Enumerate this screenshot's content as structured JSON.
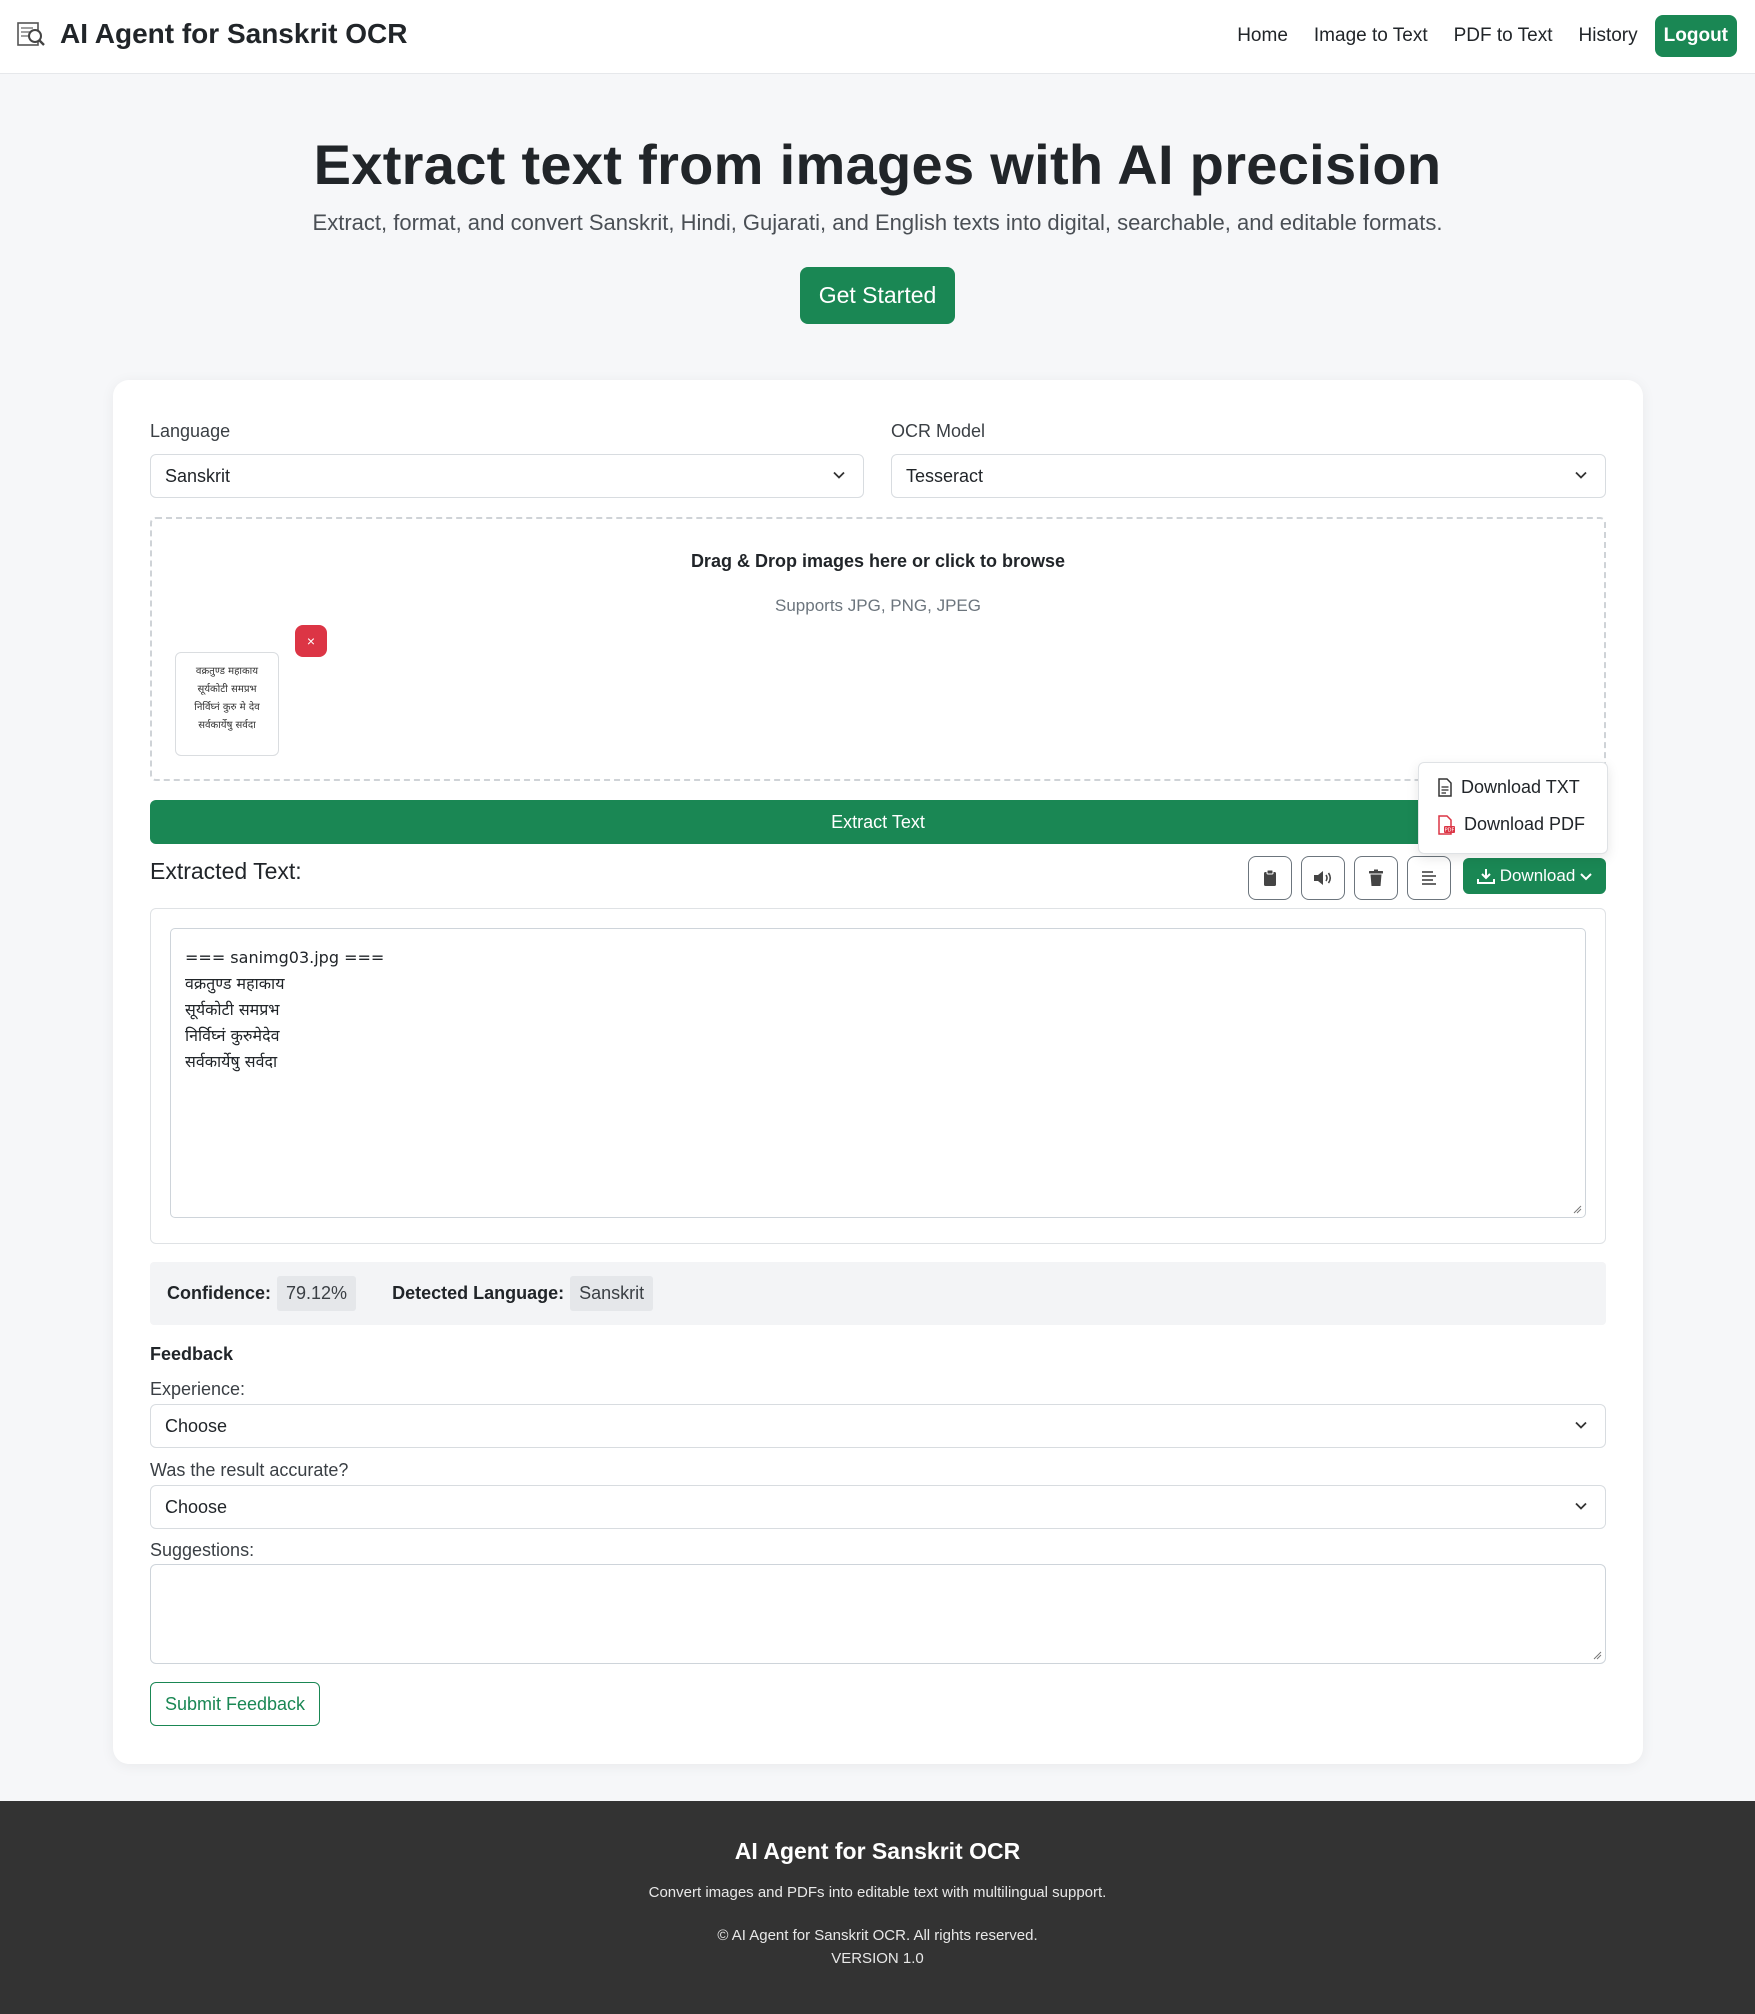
{
  "navbar": {
    "brand_title": "AI Agent for Sanskrit OCR",
    "links": [
      "Home",
      "Image to Text",
      "PDF to Text",
      "History"
    ],
    "logout_label": "Logout"
  },
  "hero": {
    "title": "Extract text from images with AI precision",
    "subtitle": "Extract, format, and convert Sanskrit, Hindi, Gujarati, and English texts into digital, searchable, and editable formats.",
    "cta_label": "Get Started"
  },
  "ocr_form": {
    "language_label": "Language",
    "language_value": "Sanskrit",
    "model_label": "OCR Model",
    "model_value": "Tesseract",
    "dropzone_title": "Drag & Drop images here or click to browse",
    "dropzone_sub": "Supports JPG, PNG, JPEG",
    "thumbnail_lines": [
      "वक्रतुण्ड महाकाय",
      "सूर्यकोटी समप्रभ",
      "निर्विघ्नं कुरु मे देव",
      "सर्वकार्येषु सर्वदा"
    ],
    "remove_label": "×",
    "extract_label": "Extract Text"
  },
  "download_menu": {
    "txt_label": "Download TXT",
    "pdf_label": "Download PDF"
  },
  "result": {
    "title": "Extracted Text:",
    "download_label": "Download",
    "text_lines": [
      "=== sanimg03.jpg ===",
      "वक्रतुण्ड महाकाय",
      "सूर्यकोटी समप्रभ",
      "निर्विघ्नं कुरुमेदेव",
      "सर्वकार्येषु सर्वदा"
    ],
    "confidence_label": "Confidence:",
    "confidence_value": "79.12%",
    "detected_label": "Detected Language:",
    "detected_value": "Sanskrit"
  },
  "feedback": {
    "heading": "Feedback",
    "experience_label": "Experience:",
    "experience_value": "Choose",
    "accurate_label": "Was the result accurate?",
    "accurate_value": "Choose",
    "suggestions_label": "Suggestions:",
    "submit_label": "Submit Feedback"
  },
  "footer": {
    "title": "AI Agent for Sanskrit OCR",
    "subtitle": "Convert images and PDFs into editable text with multilingual support.",
    "copyright": "© AI Agent for Sanskrit OCR. All rights reserved.",
    "version": "VERSION 1.0"
  },
  "colors": {
    "primary": "#1a8754",
    "danger": "#dc3545",
    "footer_bg": "#333333"
  }
}
